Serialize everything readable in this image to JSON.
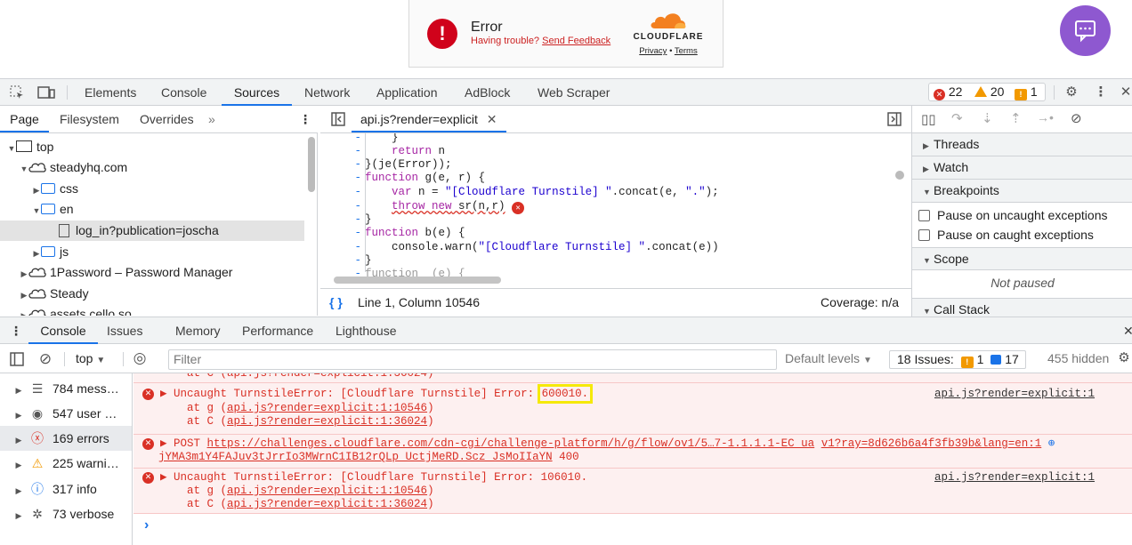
{
  "widget": {
    "error_title": "Error",
    "sub_text": "Having trouble?",
    "feedback_link": "Send Feedback",
    "brand": "CLOUDFLARE",
    "privacy": "Privacy",
    "dot": "•",
    "terms": "Terms"
  },
  "devtools": {
    "tabs": [
      "Elements",
      "Console",
      "Sources",
      "Network",
      "Application",
      "AdBlock",
      "Web Scraper"
    ],
    "active_tab": "Sources",
    "error_count": "22",
    "warning_count": "20",
    "issue_count": "1"
  },
  "navigator": {
    "tabs": [
      "Page",
      "Filesystem",
      "Overrides"
    ],
    "more": "»",
    "tree": [
      {
        "label": "top",
        "kind": "frame"
      },
      {
        "label": "steadyhq.com",
        "kind": "domain"
      },
      {
        "label": "css",
        "kind": "folder"
      },
      {
        "label": "en",
        "kind": "folder"
      },
      {
        "label": "log_in?publication=joscha",
        "kind": "file"
      },
      {
        "label": "js",
        "kind": "folder"
      },
      {
        "label": "1Password – Password Manager",
        "kind": "domain"
      },
      {
        "label": "Steady",
        "kind": "domain"
      },
      {
        "label": "assets.cello.so",
        "kind": "domain"
      }
    ]
  },
  "editor": {
    "file_tab": "api.js?render=explicit",
    "lines": {
      "l0": "    }",
      "l1a": "    ",
      "l1b": "return",
      "l1c": " n",
      "l2": "}(je(Error));",
      "l3a": "function",
      "l3b": " g(e, r) {",
      "l4a": "    ",
      "l4b": "var",
      "l4c": " n = ",
      "l4d": "\"[Cloudflare Turnstile] \"",
      "l4e": ".concat(e, ",
      "l4f": "\".\"",
      "l4g": ");",
      "l5a": "    ",
      "l5b": "throw new",
      "l5c": " sr(n,r)",
      "l6": "}",
      "l7a": "function",
      "l7b": " b(e) {",
      "l8a": "    console.warn(",
      "l8b": "\"[Cloudflare Turnstile] \"",
      "l8c": ".concat(e))",
      "l9": "}",
      "l10": "function _(e) {"
    },
    "cursor": "Line 1, Column 10546",
    "coverage": "Coverage: n/a"
  },
  "debugger": {
    "threads": "Threads",
    "watch": "Watch",
    "breakpoints": "Breakpoints",
    "pause_uncaught": "Pause on uncaught exceptions",
    "pause_caught": "Pause on caught exceptions",
    "scope": "Scope",
    "not_paused": "Not paused",
    "call_stack": "Call Stack"
  },
  "drawer": {
    "tabs": [
      "Console",
      "Issues",
      "Memory",
      "Performance",
      "Lighthouse"
    ],
    "context": "top",
    "filter_placeholder": "Filter",
    "default_levels": "Default levels",
    "issues_label": "18 Issues:",
    "issues_warn": "1",
    "issues_info": "17",
    "hidden": "455 hidden"
  },
  "sidebar": [
    {
      "label": "784 mess…",
      "icon": "list-icon"
    },
    {
      "label": "547 user …",
      "icon": "user-icon"
    },
    {
      "label": "169 errors",
      "icon": "error-icon"
    },
    {
      "label": "225 warni…",
      "icon": "warning-icon"
    },
    {
      "label": "317 info",
      "icon": "info-icon"
    },
    {
      "label": "73 verbose",
      "icon": "bug-icon"
    }
  ],
  "console": {
    "top_partial": "    at C (api.js?render=explicit:1:36024)",
    "m1": {
      "prefix": "▶ Uncaught TurnstileError: [Cloudflare Turnstile] Error: ",
      "code": "600010.",
      "at_g_pre": "    at g (",
      "at_g_link": "api.js?render=explicit:1:10546",
      "close": ")",
      "at_c_pre": "    at C (",
      "at_c_link": "api.js?render=explicit:1:36024",
      "source": "api.js?render=explicit:1"
    },
    "m2": {
      "prefix": "▶ POST ",
      "url": "https://challenges.cloudflare.com/cdn-cgi/challenge-platform/h/g/flow/ov1/5…7-1.1.1.1-EC_ua",
      "url2": "v1?ray=8d626b6a4f3fb39b&lang=en:1",
      "line2": "jYMA3m1Y4FAJuv3tJrrIo3MWrnC1IB12rQLp_UctjMeRD.Scz_JsMoIIaYN",
      "status": " 400"
    },
    "m3": {
      "text": "▶ Uncaught TurnstileError: [Cloudflare Turnstile] Error: 106010.",
      "at_g_pre": "    at g (",
      "at_g_link": "api.js?render=explicit:1:10546",
      "close": ")",
      "at_c_pre": "    at C (",
      "at_c_link": "api.js?render=explicit:1:36024",
      "source": "api.js?render=explicit:1"
    },
    "prompt": "›"
  }
}
